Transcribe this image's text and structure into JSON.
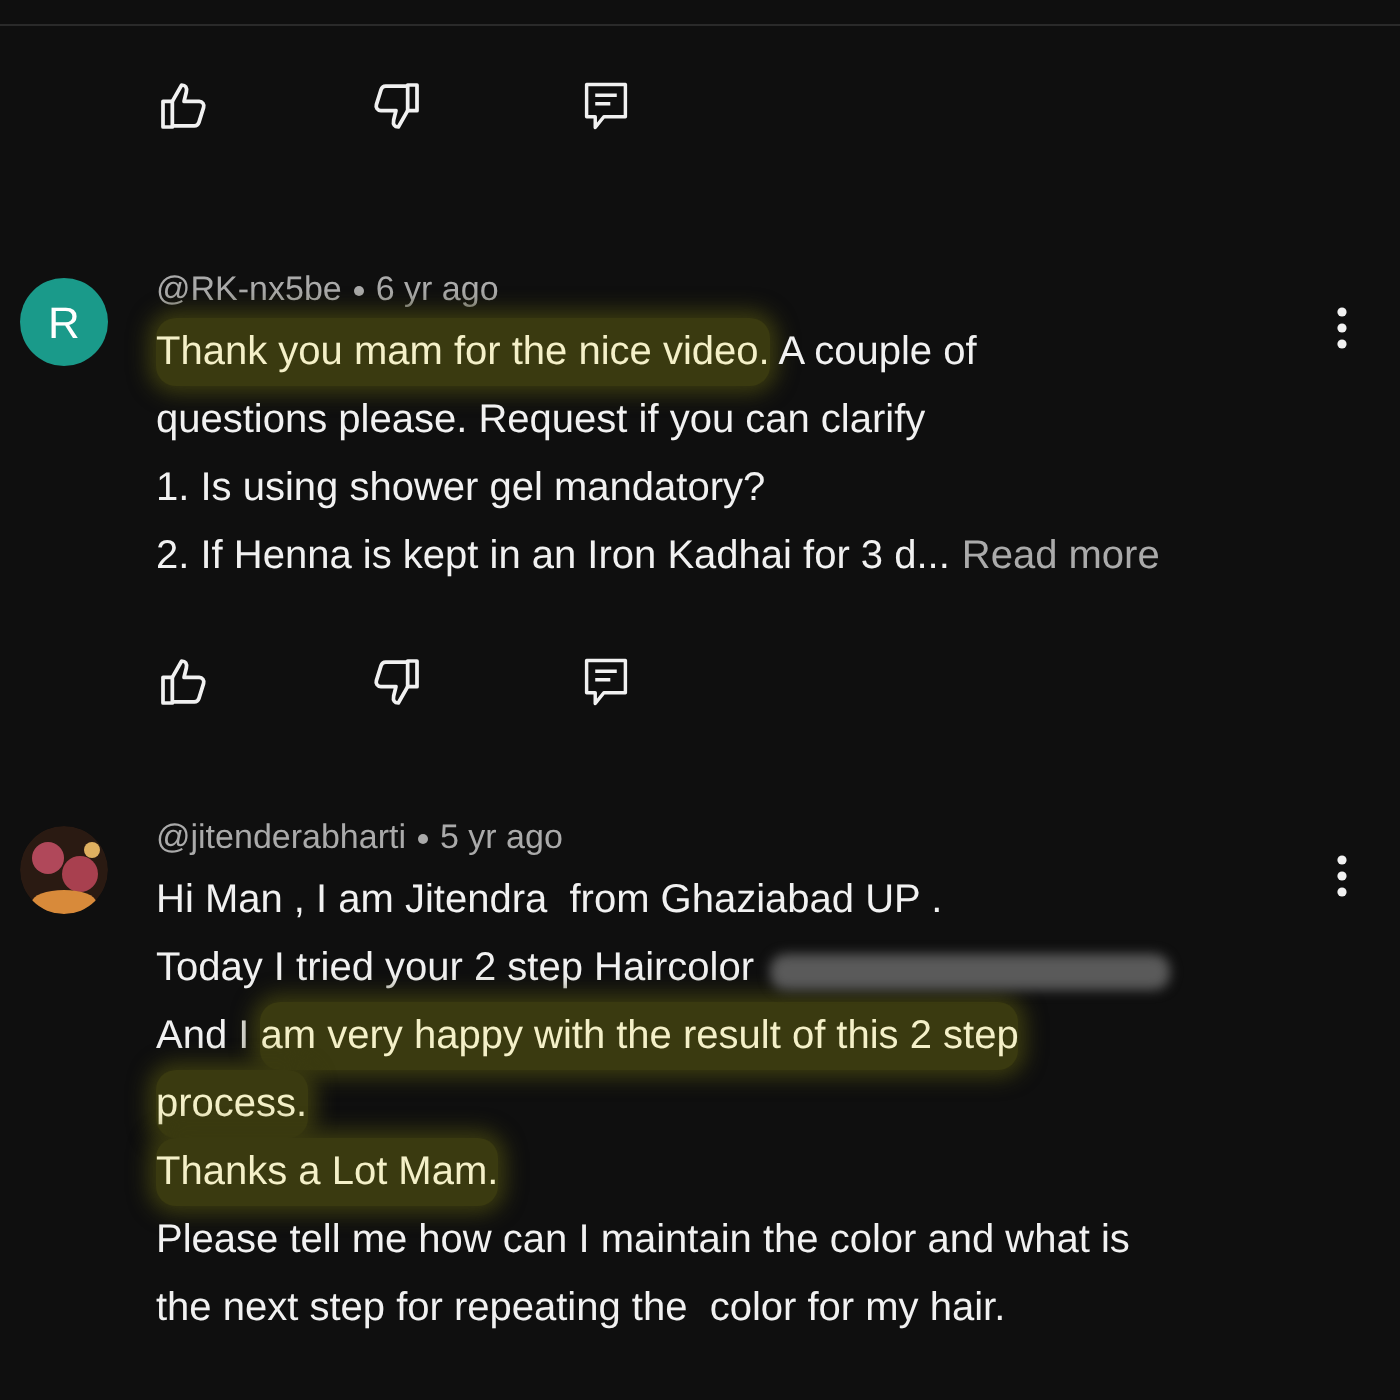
{
  "comments": [
    {
      "avatar": {
        "kind": "letter",
        "letter": "R",
        "color": "#1a9a8a"
      },
      "author": "@RK-nx5be",
      "time": "6 yr ago",
      "lines": [
        [
          {
            "text": "Thank you mam for the nice video.",
            "highlighted": true
          },
          {
            "text": " A couple of",
            "highlighted": false
          }
        ],
        [
          {
            "text": "questions please. Request if you can clarify",
            "highlighted": false
          }
        ],
        [
          {
            "text": "1. Is using shower gel mandatory?",
            "highlighted": false
          }
        ],
        [
          {
            "text": "2. If Henna is kept in an Iron Kadhai for 3 d...",
            "highlighted": false
          }
        ]
      ],
      "read_more": "Read more"
    },
    {
      "avatar": {
        "kind": "picture"
      },
      "author": "@jitenderabharti",
      "time": "5 yr ago",
      "lines": [
        [
          {
            "text": "Hi Man , I am Jitendra  from Ghaziabad UP .",
            "highlighted": false
          }
        ],
        [
          {
            "text": "Today I tried your 2 step Haircolor",
            "highlighted": false
          },
          {
            "kind": "blurred"
          }
        ],
        [
          {
            "text": "And I ",
            "highlighted": false
          },
          {
            "text": "am very happy with the result of this 2 step",
            "highlighted": true
          }
        ],
        [
          {
            "text": "process.",
            "highlighted": true
          }
        ],
        [
          {
            "text": "Thanks a Lot Mam.",
            "highlighted": true
          }
        ],
        [
          {
            "text": "Please tell me how can I maintain the color and what is",
            "highlighted": false
          }
        ],
        [
          {
            "text": "the next step for repeating the  color for my hair.",
            "highlighted": false
          }
        ]
      ]
    }
  ]
}
